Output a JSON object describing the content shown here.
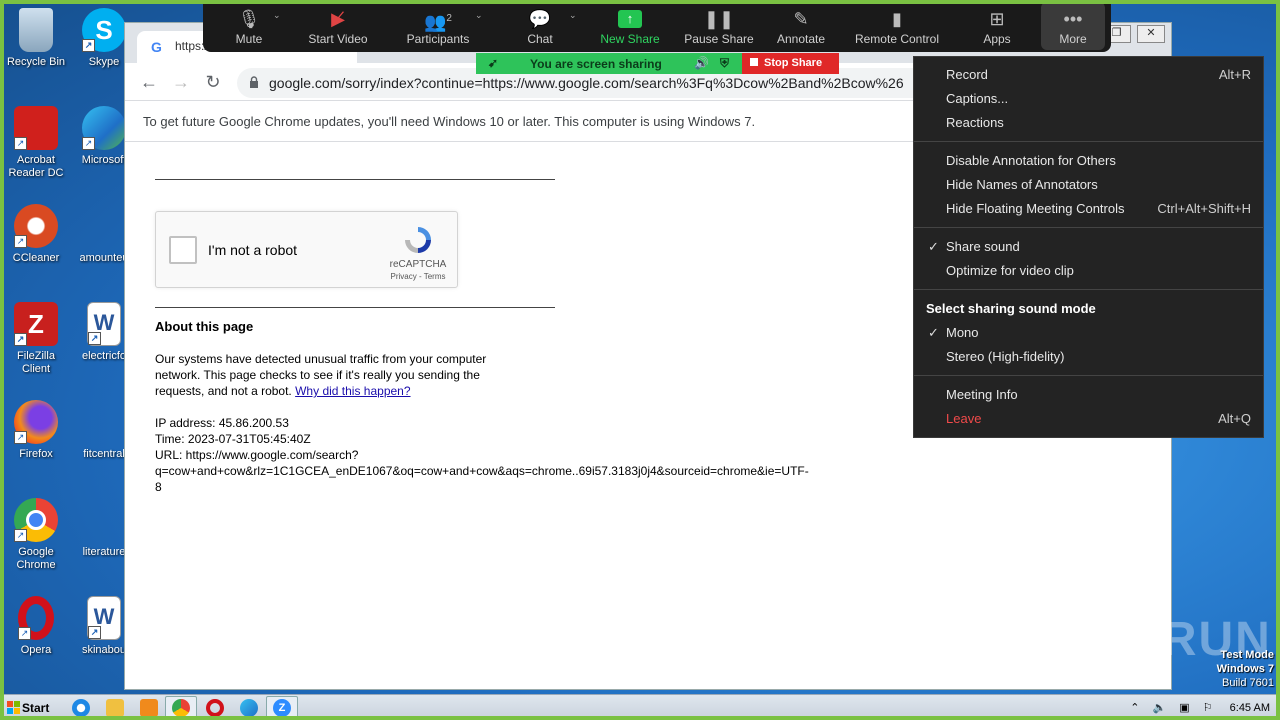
{
  "desktop": {
    "icons_col1": [
      {
        "label": "Recycle Bin",
        "icon": "recycle-bin-icon",
        "color": "#9fb7c9"
      },
      {
        "label": "Acrobat Reader DC",
        "icon": "acrobat-icon",
        "color": "#d0201c"
      },
      {
        "label": "CCleaner",
        "icon": "ccleaner-icon",
        "color": "#d94a22"
      },
      {
        "label": "FileZilla Client",
        "icon": "filezilla-icon",
        "color": "#c8201e"
      },
      {
        "label": "Firefox",
        "icon": "firefox-icon",
        "color": "#f28b1c"
      },
      {
        "label": "Google Chrome",
        "icon": "chrome-icon",
        "color": "#34a853"
      },
      {
        "label": "Opera",
        "icon": "opera-icon",
        "color": "#d1111a"
      }
    ],
    "icons_col2": [
      {
        "label": "Skype",
        "icon": "skype-icon",
        "color": "#00aff0"
      },
      {
        "label": "Microsoft",
        "icon": "edge-icon",
        "color": "#1f8fd6"
      },
      {
        "label": "amounteu",
        "icon": "blank-doc-icon",
        "color": "#ffffff"
      },
      {
        "label": "electricfo",
        "icon": "word-doc-icon",
        "color": "#2b579a"
      },
      {
        "label": "fitcentral",
        "icon": "blank-doc-icon",
        "color": "#ffffff"
      },
      {
        "label": "literature",
        "icon": "blank-doc-icon",
        "color": "#ffffff"
      },
      {
        "label": "skinabou",
        "icon": "word-doc-icon",
        "color": "#2b579a"
      }
    ]
  },
  "chrome": {
    "tab_title": "https:/",
    "url": "google.com/sorry/index?continue=https://www.google.com/search%3Fq%3Dcow%2Band%2Bcow%26",
    "infobar_text": "To get future Google Chrome updates, you'll need Windows 10 or later. This computer is using Windows 7.",
    "captcha": {
      "label": "I'm not a robot",
      "brand": "reCAPTCHA",
      "terms": "Privacy - Terms"
    },
    "about_heading": "About this page",
    "about_text": "Our systems have detected unusual traffic from your computer network. This page checks to see if it's really you sending the requests, and not a robot.",
    "about_link": "Why did this happen?",
    "ip_line": "IP address: 45.86.200.53",
    "time_line": "Time: 2023-07-31T05:45:40Z",
    "url_line1": "URL: https://www.google.com/search?",
    "url_line2": "q=cow+and+cow&rlz=1C1GCEA_enDE1067&oq=cow+and+cow&aqs=chrome..69i57.3183j0j4&sourceid=chrome&ie=UTF-",
    "url_line3": "8"
  },
  "zoom_toolbar": {
    "mute": "Mute",
    "start_video": "Start Video",
    "participants": "Participants",
    "participants_count": "2",
    "chat": "Chat",
    "new_share": "New Share",
    "pause_share": "Pause Share",
    "annotate": "Annotate",
    "remote_control": "Remote Control",
    "apps": "Apps",
    "more": "More"
  },
  "share_bar": {
    "status": "You are screen sharing",
    "stop": "Stop Share"
  },
  "more_menu": {
    "record": "Record",
    "record_shortcut": "Alt+R",
    "captions": "Captions...",
    "reactions": "Reactions",
    "disable_annotation": "Disable Annotation for Others",
    "hide_names": "Hide Names of Annotators",
    "hide_controls": "Hide Floating Meeting Controls",
    "hide_controls_shortcut": "Ctrl+Alt+Shift+H",
    "share_sound": "Share sound",
    "optimize_video": "Optimize for video clip",
    "sound_mode_heading": "Select sharing sound mode",
    "mono": "Mono",
    "stereo": "Stereo (High-fidelity)",
    "meeting_info": "Meeting Info",
    "leave": "Leave",
    "leave_shortcut": "Alt+Q"
  },
  "taskbar": {
    "start": "Start",
    "time": "6:45 AM"
  },
  "watermark": "ANY RUN",
  "test_mode": {
    "line1": "Test Mode",
    "line2": "Windows 7",
    "line3": "Build 7601"
  }
}
